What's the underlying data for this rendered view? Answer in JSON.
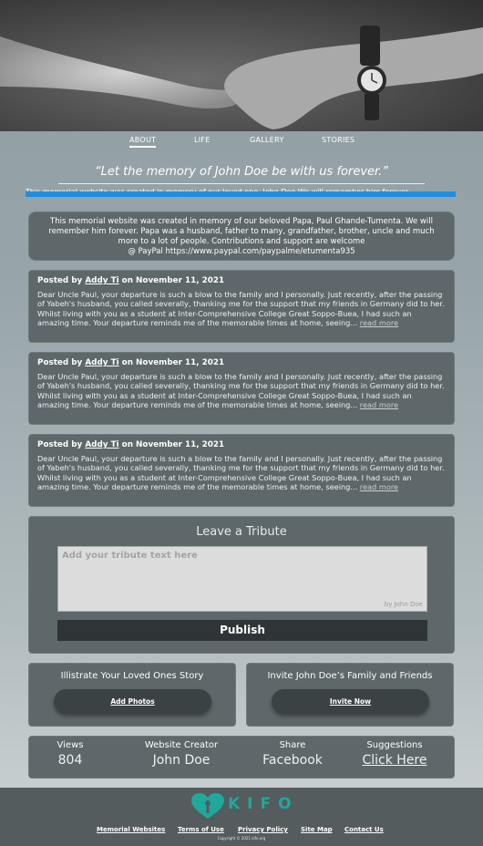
{
  "nav": {
    "about": "ABOUT",
    "life": "LIFE",
    "gallery": "GALLERY",
    "stories": "STORIES"
  },
  "quote": "“Let the memory of John Doe be with us forever.”",
  "ticker": "This memorial website was created in memory of our loved one, John Doe We will remember him forever.",
  "intro": {
    "text": "This memorial website was created in memory of our beloved Papa, Paul Ghande-Tumenta. We will remember him forever. Papa was a husband, father to many, grandfather, brother, uncle and much more to a lot of people. Contributions and support are welcome",
    "paypal_prefix": "@ PayPal",
    "paypal_link": "https://www.paypal.com/paypalme/etumenta935"
  },
  "stories": [
    {
      "posted_by": "Posted by",
      "author": "Addy Ti",
      "on": "on November 11, 2021",
      "body": "Dear Uncle Paul, your departure is such a blow to the family and I personally. Just recently, after the passing of Yabeh's husband, you called severally, thanking me for the support that my friends in Germany did to her. Whilst living with you as a student at Inter-Comprehensive College Great Soppo-Buea, I had such an amazing time. Your departure reminds me of the memorable times at home, seeing...",
      "more": "read more"
    },
    {
      "posted_by": "Posted by",
      "author": "Addy Ti",
      "on": "on November 11, 2021",
      "body": "Dear Uncle Paul, your departure is such a blow to the family and I personally. Just recently, after the passing of Yabeh's husband, you called severally, thanking me for the support that my friends in Germany did to her. Whilst living with you as a student at Inter-Comprehensive College Great Soppo-Buea, I had such an amazing time. Your departure reminds me of the memorable times at home, seeing...",
      "more": "read more"
    },
    {
      "posted_by": "Posted by",
      "author": "Addy Ti",
      "on": "on November 11, 2021",
      "body": "Dear Uncle Paul, your departure is such a blow to the family and I personally. Just recently, after the passing of Yabeh's husband, you called severally, thanking me for the support that my friends in Germany did to her. Whilst living with you as a student at Inter-Comprehensive College Great Soppo-Buea, I had such an amazing time. Your departure reminds me of the memorable times at home, seeing...",
      "more": "read more"
    }
  ],
  "tribute": {
    "title": "Leave a Tribute",
    "placeholder": "Add your tribute text here",
    "by": "by John Doe",
    "publish": "Publish"
  },
  "story_box": {
    "title": "Illistrate Your Loved Ones Story",
    "button": "Add Photos"
  },
  "invite_box": {
    "title": "Invite John Doe’s Family and Friends",
    "button": "Invite Now"
  },
  "stats": {
    "views_label": "Views",
    "views_value": "804",
    "creator_label": "Website Creator",
    "creator_value": "John Doe",
    "share_label": "Share",
    "share_value": "Facebook",
    "suggest_label": "Suggestions",
    "suggest_value": "Click Here"
  },
  "footer": {
    "logo_text": "KIFO",
    "links": [
      "Memorial Websites",
      "Terms of Use",
      "Privacy Policy",
      "Site Map",
      "Contact Us"
    ],
    "copyright": "Copyright © 2021 kifo.org"
  },
  "colors": {
    "card": "#5e6769",
    "accent_bar": "#1e8fe0",
    "logo": "#1fa89c",
    "footer": "#545c5e"
  },
  "icons": {
    "hero": "holding-hands-photo",
    "logo": "kifo-heart-logo-icon"
  }
}
